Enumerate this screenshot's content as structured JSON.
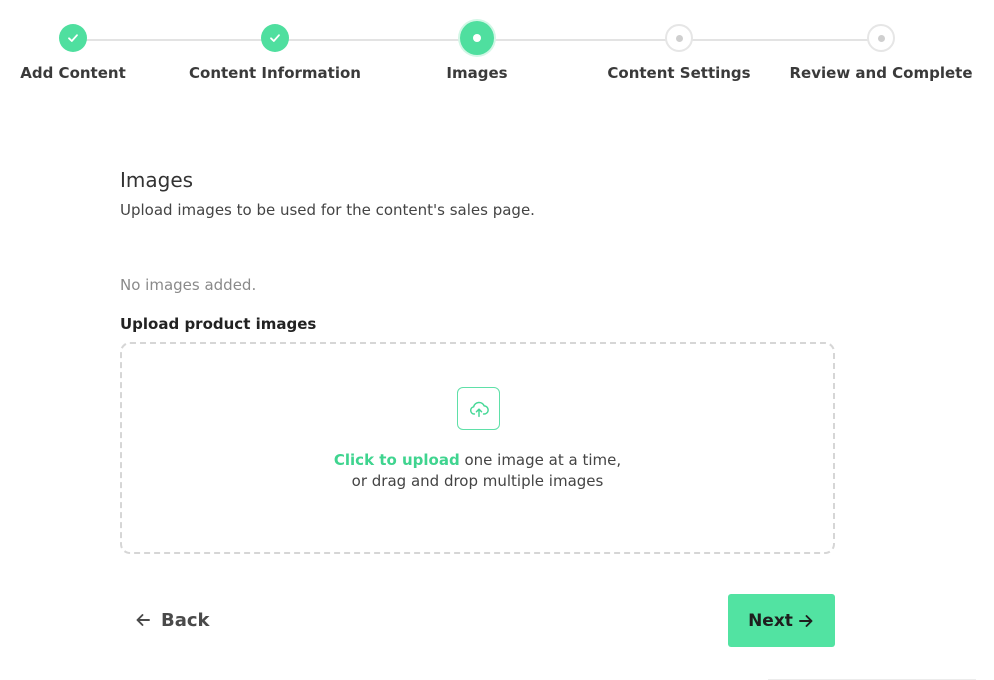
{
  "stepper": {
    "steps": [
      {
        "label": "Add Content",
        "state": "done"
      },
      {
        "label": "Content Information",
        "state": "done"
      },
      {
        "label": "Images",
        "state": "current"
      },
      {
        "label": "Content Settings",
        "state": "pending"
      },
      {
        "label": "Review and Complete",
        "state": "pending"
      }
    ],
    "icons": {
      "done": "check-icon",
      "current": "dot-icon",
      "pending": "dot-icon"
    }
  },
  "section": {
    "title": "Images",
    "subtitle": "Upload images to be used for the content's sales page."
  },
  "images": {
    "empty_text": "No images added."
  },
  "upload": {
    "label": "Upload product images",
    "icon": "cloud-upload-icon",
    "link_text": "Click to upload",
    "text_after_link": " one image at a time,",
    "second_line": "or drag and drop multiple images"
  },
  "navigation": {
    "back_label": "Back",
    "back_icon": "arrow-left-icon",
    "next_label": "Next",
    "next_icon": "arrow-right-icon"
  },
  "colors": {
    "accent": "#4fdf9f",
    "link": "#3fd48f",
    "pending": "#cfcfcf"
  }
}
